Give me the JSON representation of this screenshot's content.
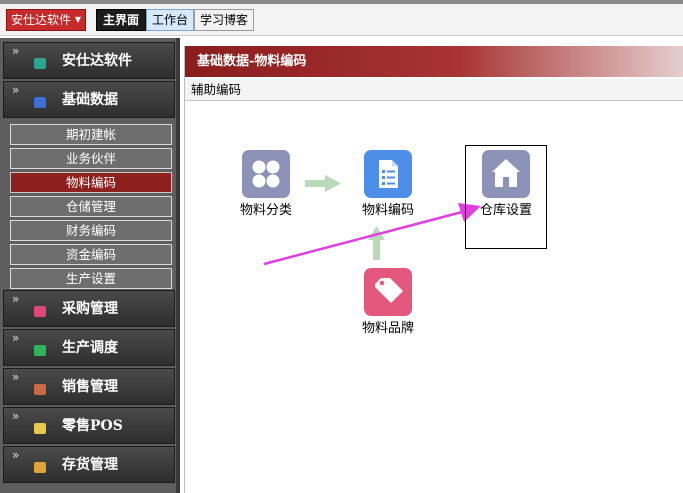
{
  "topbar": {
    "app_menu_label": "安仕达软件",
    "tabs": [
      "主界面",
      "工作台",
      "学习博客"
    ]
  },
  "sidebar": {
    "groups": [
      {
        "label": "安仕达软件",
        "icon_color": "#2aa58f"
      },
      {
        "label": "基础数据",
        "icon_color": "#3d6fd6"
      },
      {
        "label": "采购管理",
        "icon_color": "#e0467a"
      },
      {
        "label": "生产调度",
        "icon_color": "#2fb35a"
      },
      {
        "label": "销售管理",
        "icon_color": "#c96a45"
      },
      {
        "label": "零售POS",
        "icon_color": "#e8c84a"
      },
      {
        "label": "存货管理",
        "icon_color": "#e0a43a"
      }
    ],
    "sub_items": [
      "期初建帐",
      "业务伙伴",
      "物料编码",
      "仓储管理",
      "财务编码",
      "资金编码",
      "生产设置"
    ],
    "active_sub": "物料编码"
  },
  "panel": {
    "title": "基础数据-物料编码",
    "subtitle": "辅助编码",
    "nodes": [
      {
        "label": "物料分类",
        "icon": "grid-icon",
        "color": "#8d92b8"
      },
      {
        "label": "物料编码",
        "icon": "document-icon",
        "color": "#4d8ee8"
      },
      {
        "label": "仓库设置",
        "icon": "house-icon",
        "color": "#8d92b8"
      },
      {
        "label": "物料品牌",
        "icon": "tag-icon",
        "color": "#e4587e"
      }
    ]
  },
  "colors": {
    "accent_red": "#8d1f1f",
    "flow_arrow": "#b9d9b9",
    "pointer_arrow": "#e040e0"
  }
}
